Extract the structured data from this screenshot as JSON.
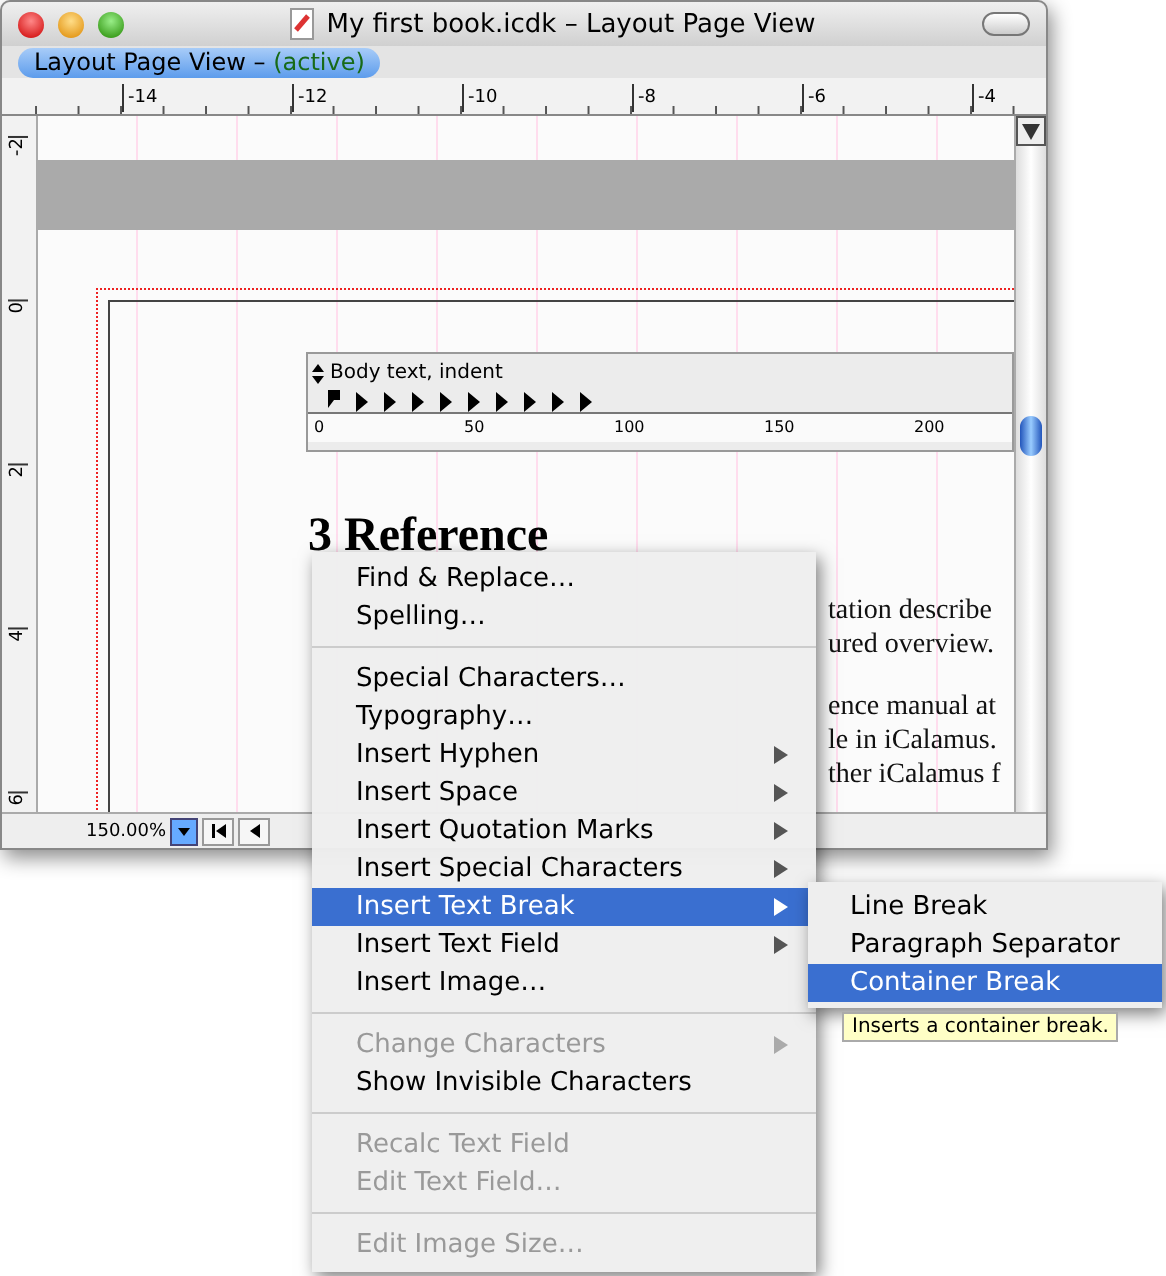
{
  "window": {
    "title": "My first book.icdk – Layout Page View"
  },
  "view_tab": {
    "label": "Layout Page View –",
    "status": "(active)",
    "selected": true
  },
  "ruler_h": [
    "-14",
    "-12",
    "-10",
    "-8",
    "-6",
    "-4"
  ],
  "ruler_v": [
    "-2",
    "0",
    "2",
    "4",
    "6"
  ],
  "text_toolbar": {
    "style": "Body text, indent",
    "ticks": [
      "0",
      "50",
      "100",
      "150",
      "200"
    ]
  },
  "document": {
    "heading": "3  Reference",
    "lines": [
      "tation describe",
      "ured overview.",
      "ence manual at",
      "le in iCalamus.",
      "ther iCalamus f"
    ]
  },
  "zoom": "150.00%",
  "context_menu": [
    {
      "kind": "item",
      "label": "Find & Replace…",
      "submenu": false,
      "disabled": false,
      "selected": false
    },
    {
      "kind": "item",
      "label": "Spelling…",
      "submenu": false,
      "disabled": false,
      "selected": false
    },
    {
      "kind": "separator"
    },
    {
      "kind": "item",
      "label": "Special Characters…",
      "submenu": false,
      "disabled": false,
      "selected": false
    },
    {
      "kind": "item",
      "label": "Typography…",
      "submenu": false,
      "disabled": false,
      "selected": false
    },
    {
      "kind": "item",
      "label": "Insert Hyphen",
      "submenu": true,
      "disabled": false,
      "selected": false
    },
    {
      "kind": "item",
      "label": "Insert Space",
      "submenu": true,
      "disabled": false,
      "selected": false
    },
    {
      "kind": "item",
      "label": "Insert Quotation Marks",
      "submenu": true,
      "disabled": false,
      "selected": false
    },
    {
      "kind": "item",
      "label": "Insert Special Characters",
      "submenu": true,
      "disabled": false,
      "selected": false
    },
    {
      "kind": "item",
      "label": "Insert Text Break",
      "submenu": true,
      "disabled": false,
      "selected": true
    },
    {
      "kind": "item",
      "label": "Insert Text Field",
      "submenu": true,
      "disabled": false,
      "selected": false
    },
    {
      "kind": "item",
      "label": "Insert Image…",
      "submenu": false,
      "disabled": false,
      "selected": false
    },
    {
      "kind": "separator"
    },
    {
      "kind": "item",
      "label": "Change Characters",
      "submenu": true,
      "disabled": true,
      "selected": false
    },
    {
      "kind": "item",
      "label": "Show Invisible Characters",
      "submenu": false,
      "disabled": false,
      "selected": false
    },
    {
      "kind": "separator"
    },
    {
      "kind": "item",
      "label": "Recalc Text Field",
      "submenu": false,
      "disabled": true,
      "selected": false
    },
    {
      "kind": "item",
      "label": "Edit Text Field…",
      "submenu": false,
      "disabled": true,
      "selected": false
    },
    {
      "kind": "separator"
    },
    {
      "kind": "item",
      "label": "Edit Image Size…",
      "submenu": false,
      "disabled": true,
      "selected": false
    }
  ],
  "submenu": [
    {
      "label": "Line Break",
      "selected": false
    },
    {
      "label": "Paragraph Separator",
      "selected": false
    },
    {
      "label": "Container Break",
      "selected": true
    }
  ],
  "tooltip": "Inserts a container break."
}
